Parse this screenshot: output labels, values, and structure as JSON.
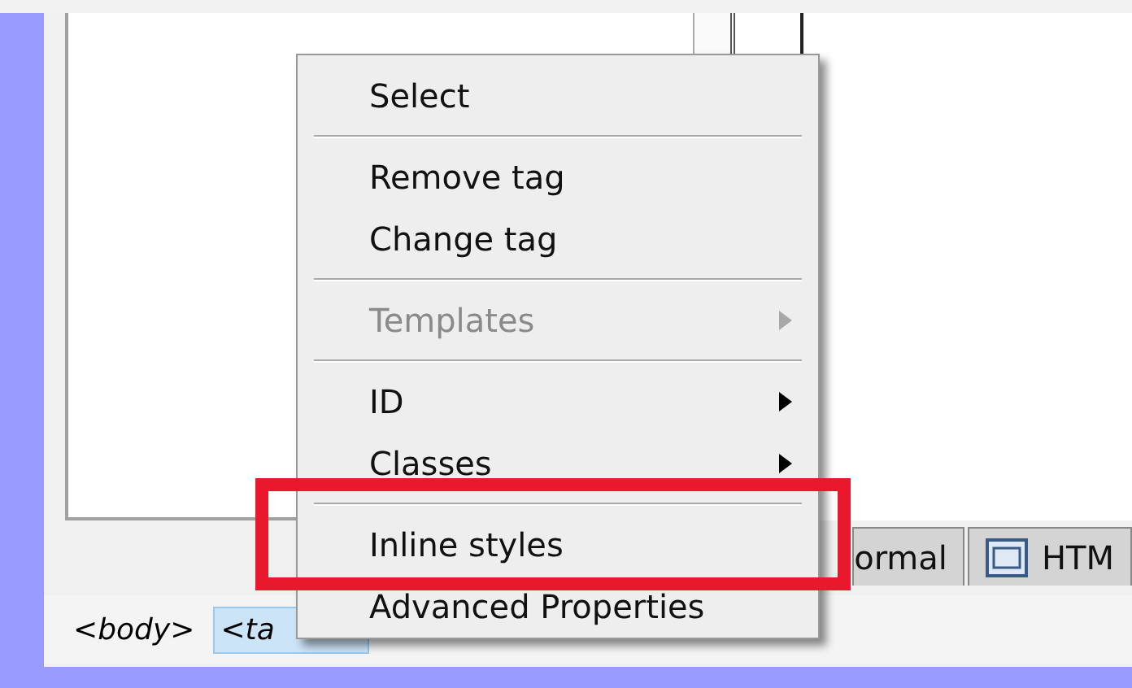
{
  "menu": {
    "items": [
      {
        "kind": "item",
        "label": "Select",
        "disabled": false,
        "submenu": false
      },
      {
        "kind": "separator"
      },
      {
        "kind": "item",
        "label": "Remove tag",
        "disabled": false,
        "submenu": false
      },
      {
        "kind": "item",
        "label": "Change tag",
        "disabled": false,
        "submenu": false
      },
      {
        "kind": "separator"
      },
      {
        "kind": "item",
        "label": "Templates",
        "disabled": true,
        "submenu": true
      },
      {
        "kind": "separator"
      },
      {
        "kind": "item",
        "label": "ID",
        "disabled": false,
        "submenu": true
      },
      {
        "kind": "item",
        "label": "Classes",
        "disabled": false,
        "submenu": true
      },
      {
        "kind": "separator"
      },
      {
        "kind": "item",
        "label": "Inline styles",
        "disabled": false,
        "submenu": false
      },
      {
        "kind": "item",
        "label": "Advanced Properties",
        "disabled": false,
        "submenu": false
      }
    ]
  },
  "view_tabs": [
    {
      "label": "ormal",
      "icon": false
    },
    {
      "label": "HTM",
      "icon": true
    }
  ],
  "tag_bar": [
    {
      "label": "<body>",
      "selected": false
    },
    {
      "label": "<ta",
      "selected": true
    }
  ]
}
